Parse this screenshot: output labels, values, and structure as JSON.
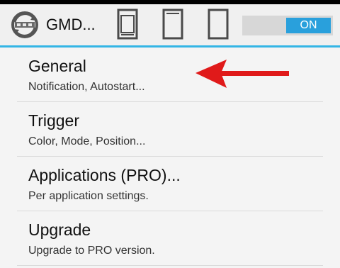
{
  "app": {
    "title": "GMD...",
    "icon": "gear-arrows-icon"
  },
  "toolbar": {
    "phone_buttons": [
      "phone-portrait-icon",
      "phone-blank-icon",
      "phone-outline-icon"
    ],
    "toggle_label": "ON",
    "toggle_state": true,
    "accent_color": "#29a0dc"
  },
  "settings": {
    "items": [
      {
        "title": "General",
        "subtitle": "Notification, Autostart..."
      },
      {
        "title": "Trigger",
        "subtitle": "Color, Mode, Position..."
      },
      {
        "title": "Applications (PRO)...",
        "subtitle": "Per application settings."
      },
      {
        "title": "Upgrade",
        "subtitle": "Upgrade to PRO version."
      }
    ]
  },
  "annotation": {
    "arrow_color": "#e01a1a",
    "arrow_icon": "left-arrow-icon"
  }
}
